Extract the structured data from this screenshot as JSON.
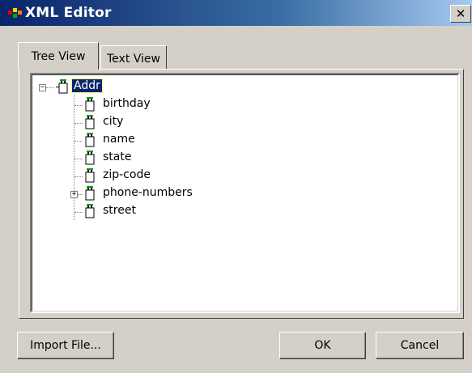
{
  "window": {
    "title": "XML Editor",
    "close_label": "✕"
  },
  "tabs": [
    {
      "label": "Tree View",
      "active": true
    },
    {
      "label": "Text View",
      "active": false
    }
  ],
  "tree": {
    "root": {
      "label": "Addr",
      "expanded": true,
      "selected": true
    },
    "children": [
      {
        "label": "birthday",
        "expandable": false
      },
      {
        "label": "city",
        "expandable": false
      },
      {
        "label": "name",
        "expandable": false
      },
      {
        "label": "state",
        "expandable": false
      },
      {
        "label": "zip-code",
        "expandable": false
      },
      {
        "label": "phone-numbers",
        "expandable": true,
        "expanded": false
      },
      {
        "label": "street",
        "expandable": false
      }
    ],
    "icon": "xml-element-icon",
    "collapse_glyph": "−",
    "expand_glyph": "+"
  },
  "buttons": {
    "import": "Import File...",
    "ok": "OK",
    "cancel": "Cancel"
  },
  "colors": {
    "title_start": "#0a246a",
    "title_end": "#a6caf0",
    "face": "#d4d0c8",
    "selection": "#0a246a"
  }
}
